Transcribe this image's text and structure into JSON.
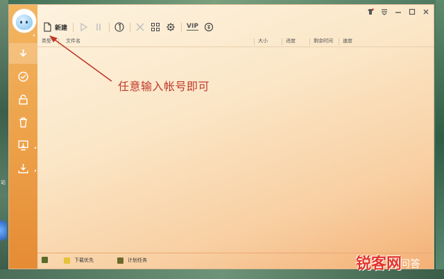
{
  "toolbar": {
    "new_label": "新建",
    "vip_label": "VIP"
  },
  "columns": {
    "type": "类型",
    "filename": "文件名",
    "size": "大小",
    "progress": "进度",
    "remaining_time": "剩余时间",
    "speed": "速度"
  },
  "annotation": {
    "text": "任意输入帐号即可",
    "color": "#c0392b"
  },
  "statusbar": {
    "download_priority": "下载优先",
    "scheduled_task": "计划任务"
  },
  "desktop": {
    "icon_label": "站"
  },
  "watermark": {
    "brand": "锐客网",
    "suffix": "问答"
  },
  "sidebar": {
    "items": [
      {
        "icon": "download-icon",
        "active": true
      },
      {
        "icon": "check-circle-icon",
        "active": false
      },
      {
        "icon": "unlock-icon",
        "active": false
      },
      {
        "icon": "trash-icon",
        "active": false
      },
      {
        "icon": "monitor-download-icon",
        "active": false
      },
      {
        "icon": "download-tray-icon",
        "active": false
      }
    ]
  },
  "colors": {
    "accent": "#f0a048",
    "annotation": "#c0392b",
    "watermark": "#e1352b"
  }
}
